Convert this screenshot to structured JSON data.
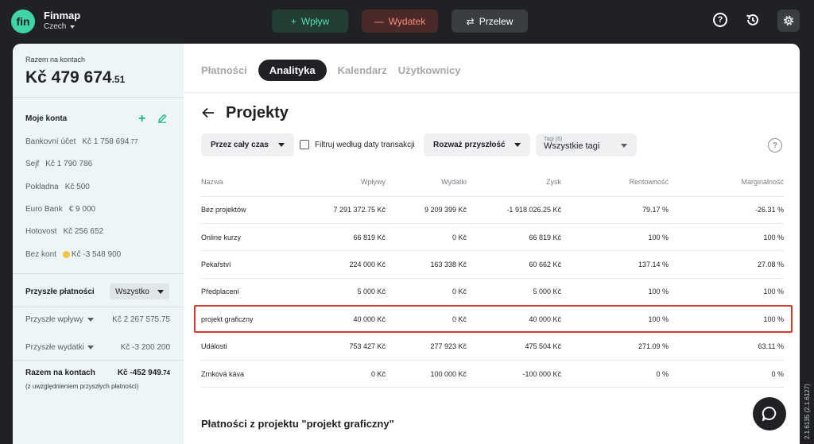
{
  "app": {
    "logo_text": "fin",
    "name": "Finmap",
    "company": "Czech"
  },
  "actions": {
    "income_label": "Wpływ",
    "expense_label": "Wydatek",
    "transfer_label": "Przelew"
  },
  "sidebar": {
    "total_label": "Razem na kontach",
    "total_main": "Kč 479 674",
    "total_decimal": ".51",
    "accounts_title": "Moje konta",
    "accounts": [
      {
        "name": "Bankovní účet",
        "amount_main": "Kč 1 758 694",
        "amount_decimal": ".77"
      },
      {
        "name": "Sejf",
        "amount_main": "Kč 1 790 786",
        "amount_decimal": ""
      },
      {
        "name": "Pokladna",
        "amount_main": "Kč 500",
        "amount_decimal": ""
      },
      {
        "name": "Euro Bank",
        "amount_main": "€ 9 000",
        "amount_decimal": ""
      },
      {
        "name": "Hotovost",
        "amount_main": "Kč 256 652",
        "amount_decimal": ""
      },
      {
        "name": "Bez kont",
        "amount_main": "Kč -3 548 900",
        "amount_decimal": ""
      }
    ],
    "future_title": "Przyszłe płatności",
    "future_filter": "Wszystko",
    "future_income_label": "Przyszłe wpływy",
    "future_income_amount": "Kč 2 267 575.75",
    "future_expense_label": "Przyszłe wydatki",
    "future_expense_amount": "Kč -3 200 200",
    "sum_label": "Razem na kontach",
    "sum_main": "Kč -452 949",
    "sum_decimal": ".74",
    "sum_note": "(z uwzględnieniem przyszłych płatności)"
  },
  "tabs": [
    {
      "label": "Płatności",
      "active": false
    },
    {
      "label": "Analityka",
      "active": true
    },
    {
      "label": "Kalendarz",
      "active": false
    },
    {
      "label": "Użytkownicy",
      "active": false
    }
  ],
  "page": {
    "title": "Projekty",
    "filter_period": "Przez cały czas",
    "filter_checkbox_label": "Filtruj według daty transakcji",
    "filter_future": "Rozważ przyszłość",
    "tags_small_label": "Tagi (6)",
    "tags_value": "Wszystkie tagi",
    "help_symbol": "?",
    "section_title": "Płatności z projektu \"projekt graficzny\""
  },
  "table": {
    "headers": [
      "Nazwa",
      "Wpływy",
      "Wydatki",
      "Zysk",
      "Rentowność",
      "Marginalność"
    ],
    "rows": [
      [
        "Bez projektów",
        "7 291 372.75 Kč",
        "9 209 399 Kč",
        "-1 918 026.25 Kč",
        "79.17 %",
        "-26.31 %"
      ],
      [
        "Online kurzy",
        "66 819 Kč",
        "0 Kč",
        "66 819 Kč",
        "100 %",
        "100 %"
      ],
      [
        "Pekařství",
        "224 000 Kč",
        "163 338 Kč",
        "60 662 Kč",
        "137.14 %",
        "27.08 %"
      ],
      [
        "Předplacení",
        "5 000 Kč",
        "0 Kč",
        "5 000 Kč",
        "100 %",
        "100 %"
      ],
      [
        "projekt graficzny",
        "40 000 Kč",
        "0 Kč",
        "40 000 Kč",
        "100 %",
        "100 %"
      ],
      [
        "Události",
        "753 427 Kč",
        "277 923 Kč",
        "475 504 Kč",
        "271.09 %",
        "63.11 %"
      ],
      [
        "Zrnková káva",
        "0 Kč",
        "100 000 Kč",
        "-100 000 Kč",
        "0 %",
        "0 %"
      ]
    ],
    "highlighted_row": "projekt graficzny"
  },
  "version": "2.1.6135 (2.1.6127)",
  "colors": {
    "brand_green": "#3fd3a8",
    "income": "#4ee3b0",
    "expense": "#ff8a76",
    "highlight": "#d63a2f",
    "dark": "#1f2124"
  }
}
